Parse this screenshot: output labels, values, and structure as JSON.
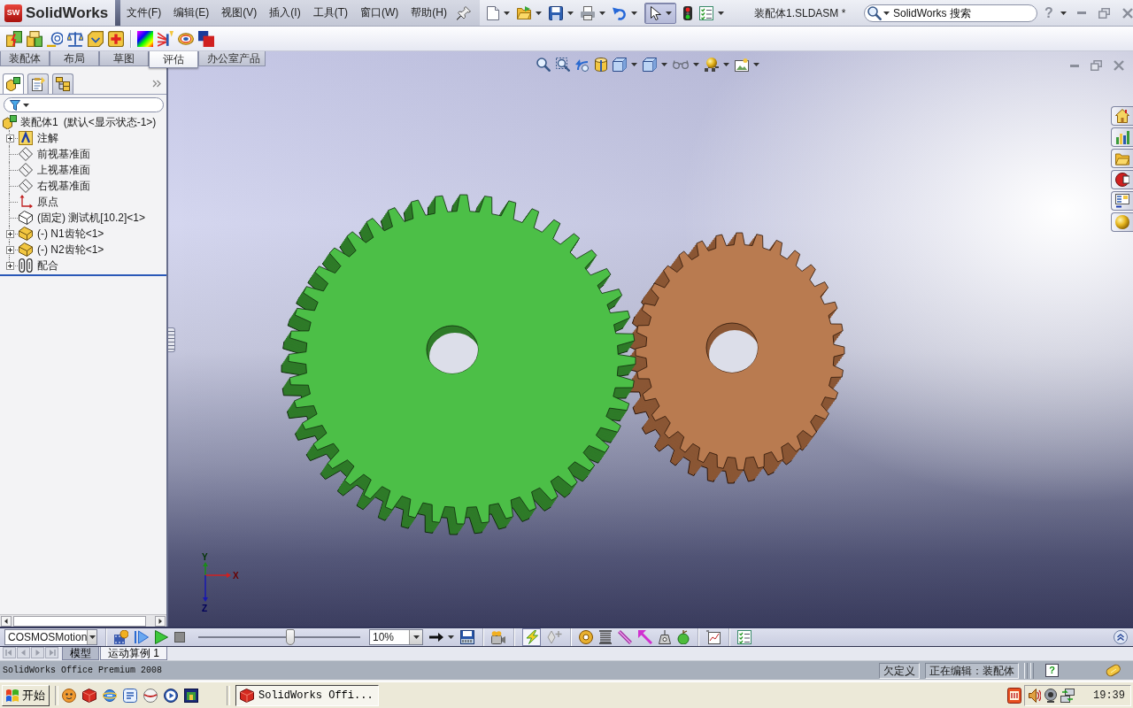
{
  "title_bar": {
    "logo_mark": "SW",
    "logo_text": "SolidWorks",
    "menu": [
      "文件(F)",
      "编辑(E)",
      "视图(V)",
      "插入(I)",
      "工具(T)",
      "窗口(W)",
      "帮助(H)"
    ],
    "select_tool": {
      "pressed": true
    },
    "document_title": "装配体1.SLDASM *",
    "search": {
      "placeholder": "SolidWorks 搜索"
    },
    "help": "?"
  },
  "command_tabs": [
    {
      "label": "装配体",
      "selected": false
    },
    {
      "label": "布局",
      "selected": false
    },
    {
      "label": "草图",
      "selected": false
    },
    {
      "label": "评估",
      "selected": true
    },
    {
      "label": "办公室产品",
      "selected": false
    }
  ],
  "feature_manager": {
    "panel_tabs": [
      {
        "selected": true
      },
      {
        "selected": false
      },
      {
        "selected": false
      }
    ],
    "root": {
      "label": "装配体1",
      "configuration": "(默认<显示状态-1>)"
    },
    "items": [
      {
        "kind": "annotations",
        "label": "注解",
        "expandable": true
      },
      {
        "kind": "plane",
        "label": "前视基准面",
        "expandable": false
      },
      {
        "kind": "plane",
        "label": "上视基准面",
        "expandable": false
      },
      {
        "kind": "plane",
        "label": "右视基准面",
        "expandable": false
      },
      {
        "kind": "origin",
        "label": "原点",
        "expandable": false
      },
      {
        "kind": "fixed_part",
        "label": "(固定) 测试机[10.2]<1>",
        "expandable": false
      },
      {
        "kind": "part",
        "label": "(-) N1齿轮<1>",
        "expandable": true
      },
      {
        "kind": "part",
        "label": "(-) N2齿轮<1>",
        "expandable": true
      },
      {
        "kind": "mates",
        "label": "配合",
        "expandable": true
      }
    ]
  },
  "viewport": {
    "triad": {
      "y_label": "Y",
      "x_label": "X",
      "z_label": "Z"
    }
  },
  "motion_manager": {
    "study_type": "COSMOSMotion",
    "timeline": {
      "level": 0.57
    },
    "playback_speed": "10%",
    "autokey": {
      "pressed": true
    },
    "tabs": [
      {
        "label": "模型",
        "selected": false
      },
      {
        "label": "运动算例 1",
        "selected": true
      }
    ]
  },
  "status_bar": {
    "product": "SolidWorks Office Premium 2008",
    "sections": [
      "欠定义",
      "正在编辑：装配体"
    ],
    "help": "?"
  },
  "taskbar": {
    "start": "开始",
    "tasks": [
      {
        "label": "SolidWorks Offi...",
        "selected": true
      }
    ],
    "clock": "19:39"
  }
}
